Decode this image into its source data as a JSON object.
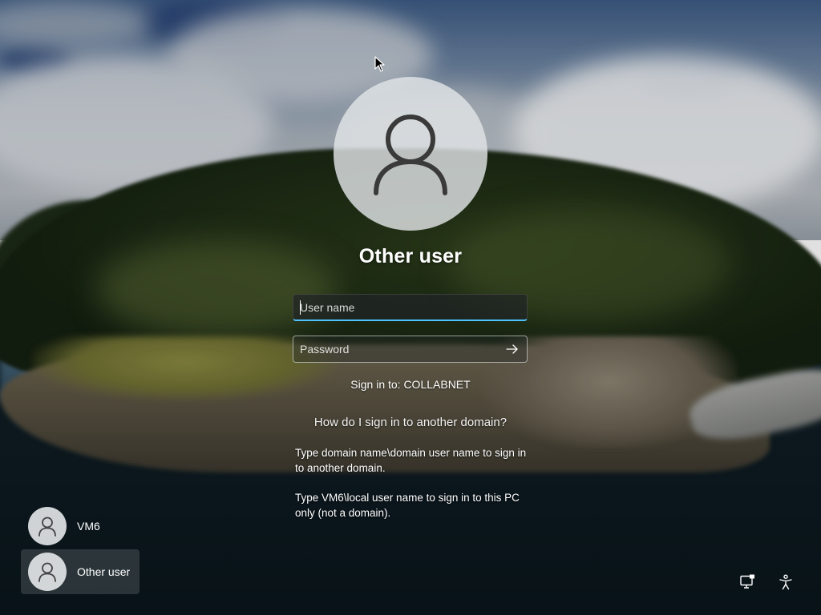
{
  "login": {
    "account_name": "Other user",
    "username_placeholder": "User name",
    "password_placeholder": "Password",
    "sign_in_to": "Sign in to: COLLABNET",
    "help_link": "How do I sign in to another domain?",
    "help_text_1": "Type domain name\\domain user name to sign in to another domain.",
    "help_text_2": "Type VM6\\local user name to sign in to this PC only (not a domain).",
    "submit_icon": "arrow-right-icon",
    "avatar_icon": "person-icon"
  },
  "users": [
    {
      "name": "VM6",
      "icon": "person-icon"
    },
    {
      "name": "Other user",
      "icon": "person-icon",
      "selected": true
    }
  ],
  "corner": {
    "network_icon": "network-icon",
    "accessibility_icon": "accessibility-icon"
  },
  "colors": {
    "focus_accent": "#4cc2ff",
    "avatar_bg": "#e1e4e7",
    "avatar_glyph": "#3a3a3a"
  }
}
